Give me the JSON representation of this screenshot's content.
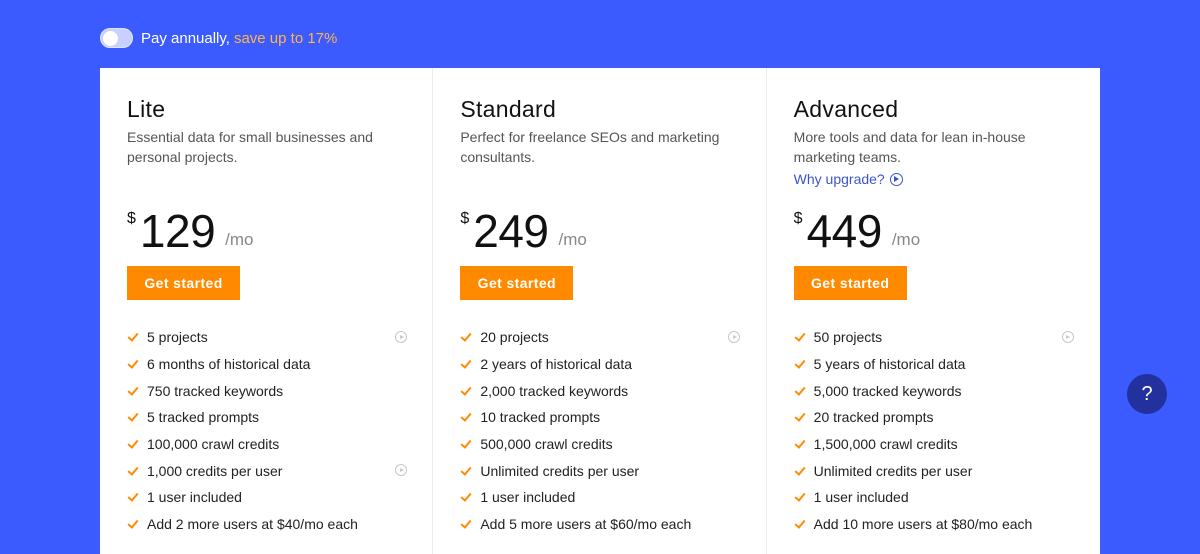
{
  "billing_toggle": {
    "label": "Pay annually,",
    "accent": "save up to 17%",
    "enabled": false
  },
  "plans": [
    {
      "name": "Lite",
      "description": "Essential data for small businesses and personal projects.",
      "currency": "$",
      "price": "129",
      "period": "/mo",
      "cta": "Get started",
      "features": [
        {
          "text": "5 projects",
          "info": true
        },
        {
          "text": "6 months of historical data",
          "info": false
        },
        {
          "text": "750 tracked keywords",
          "info": false
        },
        {
          "text": "5 tracked prompts",
          "info": false
        },
        {
          "text": "100,000 crawl credits",
          "info": false
        },
        {
          "text": "1,000 credits per user",
          "info": true
        },
        {
          "text": "1 user included",
          "info": false
        },
        {
          "text": "Add 2 more users at $40/mo each",
          "info": false
        }
      ]
    },
    {
      "name": "Standard",
      "description": "Perfect for freelance SEOs and marketing consultants.",
      "currency": "$",
      "price": "249",
      "period": "/mo",
      "cta": "Get started",
      "features": [
        {
          "text": "20 projects",
          "info": true
        },
        {
          "text": "2 years of historical data",
          "info": false
        },
        {
          "text": "2,000 tracked keywords",
          "info": false
        },
        {
          "text": "10 tracked prompts",
          "info": false
        },
        {
          "text": "500,000 crawl credits",
          "info": false
        },
        {
          "text": "Unlimited credits per user",
          "info": false
        },
        {
          "text": "1 user included",
          "info": false
        },
        {
          "text": "Add 5 more users at $60/mo each",
          "info": false
        }
      ]
    },
    {
      "name": "Advanced",
      "description": "More tools and data for lean in-house marketing teams.",
      "link": "Why upgrade?",
      "currency": "$",
      "price": "449",
      "period": "/mo",
      "cta": "Get started",
      "features": [
        {
          "text": "50 projects",
          "info": true
        },
        {
          "text": "5 years of historical data",
          "info": false
        },
        {
          "text": "5,000 tracked keywords",
          "info": false
        },
        {
          "text": "20 tracked prompts",
          "info": false
        },
        {
          "text": "1,500,000 crawl credits",
          "info": false
        },
        {
          "text": "Unlimited credits per user",
          "info": false
        },
        {
          "text": "1 user included",
          "info": false
        },
        {
          "text": "Add 10 more users at $80/mo each",
          "info": false
        }
      ]
    }
  ],
  "help_button": "?",
  "colors": {
    "background": "#3b5bff",
    "accent": "#ff8a00",
    "link": "#3e55c8",
    "help": "#22319e"
  }
}
